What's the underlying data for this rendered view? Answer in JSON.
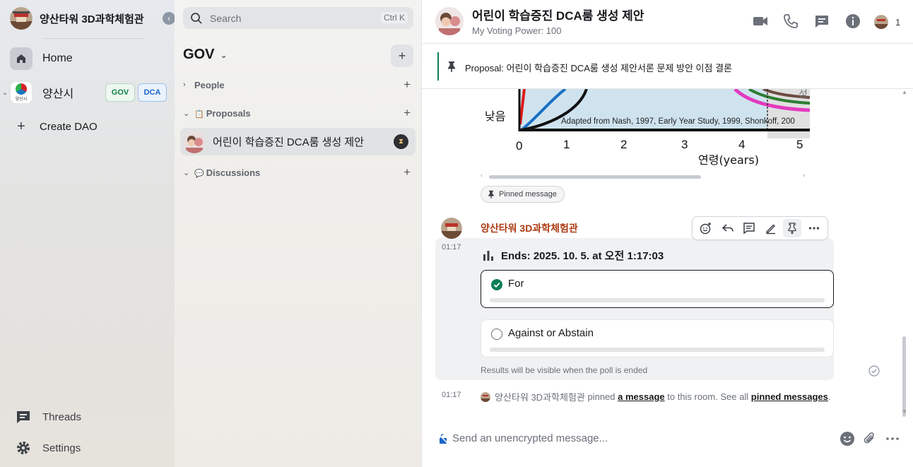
{
  "sidebar": {
    "space_name": "양산타워 3D과학체험관",
    "home": "Home",
    "yangsan": {
      "name": "양산시",
      "logo_text": "양산시",
      "tags": [
        "GOV",
        "DCA"
      ]
    },
    "create_dao": "Create DAO",
    "threads": "Threads",
    "settings": "Settings"
  },
  "room_list": {
    "search_placeholder": "Search",
    "shortcut": "Ctrl K",
    "space_title": "GOV",
    "sections": {
      "people": "People",
      "proposals": "Proposals",
      "discussions": "Discussions"
    },
    "rooms": [
      {
        "name": "어린이 학습증진 DCA룸 생성 제안",
        "status_icon": "hourglass-icon"
      }
    ]
  },
  "room": {
    "title": "어린이 학습증진 DCA룸 생성 제안",
    "subtitle": "My Voting Power: 100",
    "member_count": "1",
    "pinned_text": "Proposal: 어린이 학습증진 DCA룸 생성 제안서론 문제 방안 이점 결론",
    "image_labels": {
      "low": "낮음",
      "citation": "Adapted from Nash, 1997, Early Year Study, 1999, Shonkoff, 200",
      "ticks": [
        "0",
        "1",
        "2",
        "3",
        "4",
        "5"
      ],
      "axis": "연령(years)",
      "corner": "성"
    },
    "pinned_chip": "Pinned message",
    "message": {
      "sender": "양산타워 3D과학체험관",
      "time": "01:17",
      "poll": {
        "ends": "Ends: 2025. 10. 5. at 오전 1:17:03",
        "options": [
          {
            "label": "For",
            "selected": true
          },
          {
            "label": "Against or Abstain",
            "selected": false
          }
        ],
        "note": "Results will be visible when the poll is ended"
      }
    },
    "event": {
      "time": "01:17",
      "actor": "양산타워 3D과학체험관",
      "text_a": " pinned ",
      "link_a": "a message",
      "text_b": " to this room. See all ",
      "link_b": "pinned messages",
      "text_c": "."
    },
    "composer_placeholder": "Send an unencrypted message..."
  },
  "colors": {
    "accent": "#0d7f56",
    "sender": "#ac3b13",
    "selected_check": "#0d7f56"
  }
}
